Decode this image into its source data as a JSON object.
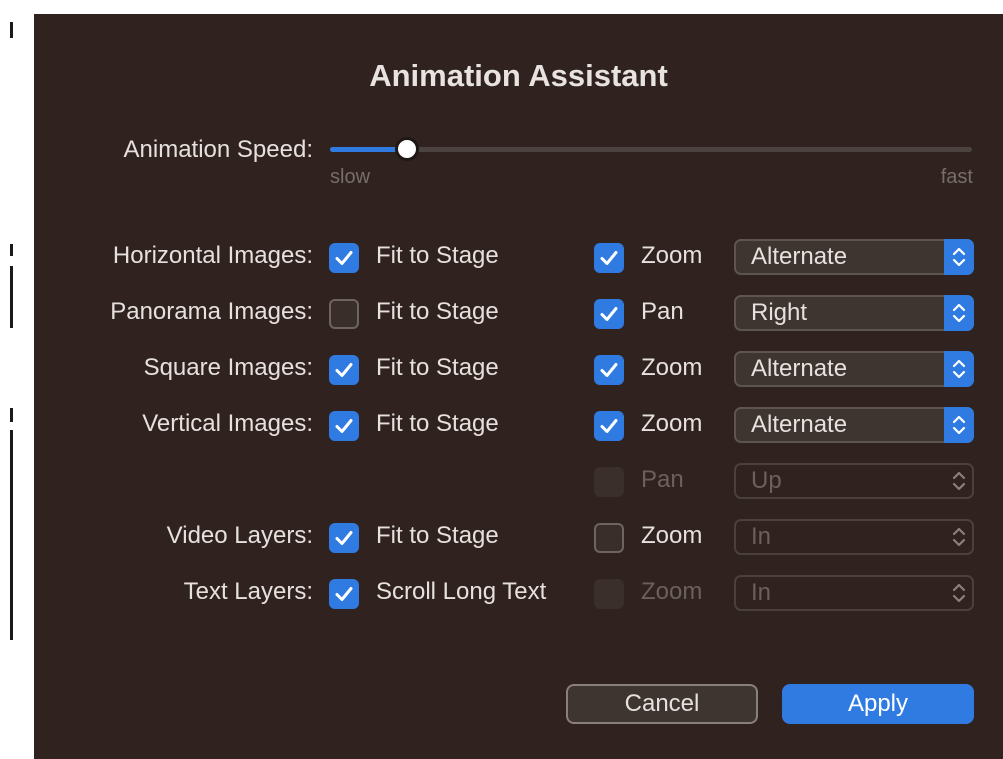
{
  "dialog": {
    "title": "Animation Assistant"
  },
  "speed": {
    "label": "Animation Speed:",
    "min_label": "slow",
    "max_label": "fast",
    "value": 0.12
  },
  "rows": [
    {
      "label": "Horizontal Images:",
      "opt1": "Fit to Stage",
      "opt1_checked": true,
      "opt2": "Zoom",
      "opt2_checked": true,
      "select": "Alternate"
    },
    {
      "label": "Panorama Images:",
      "opt1": "Fit to Stage",
      "opt1_checked": false,
      "opt2": "Pan",
      "opt2_checked": true,
      "select": "Right"
    },
    {
      "label": "Square Images:",
      "opt1": "Fit to Stage",
      "opt1_checked": true,
      "opt2": "Zoom",
      "opt2_checked": true,
      "select": "Alternate"
    },
    {
      "label": "Vertical Images:",
      "opt1": "Fit to Stage",
      "opt1_checked": true,
      "opt2": "Zoom",
      "opt2_checked": true,
      "select": "Alternate"
    },
    {
      "label": "",
      "opt2": "Pan",
      "opt2_checked": false,
      "opt2_disabled": true,
      "select": "Up",
      "select_disabled": true
    },
    {
      "label": "Video Layers:",
      "opt1": "Fit to Stage",
      "opt1_checked": true,
      "opt2": "Zoom",
      "opt2_checked": false,
      "select": "In",
      "select_disabled": true
    },
    {
      "label": "Text Layers:",
      "opt1": "Scroll Long Text",
      "opt1_checked": true,
      "opt2": "Zoom",
      "opt2_checked": false,
      "opt2_disabled": true,
      "select": "In",
      "select_disabled": true
    }
  ],
  "buttons": {
    "cancel": "Cancel",
    "apply": "Apply"
  },
  "colors": {
    "background": "#30231f",
    "accent": "#2f7be2",
    "text": "#e6e1de",
    "disabled_text": "#6b605c"
  }
}
